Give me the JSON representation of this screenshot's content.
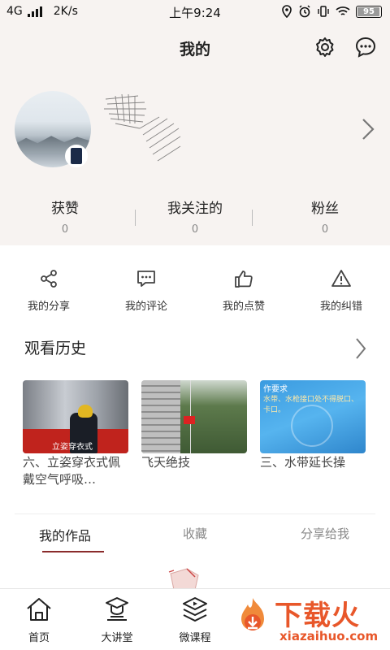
{
  "status": {
    "network": "4G",
    "speed": "2K/s",
    "time": "上午9:24",
    "battery": "95"
  },
  "header": {
    "title": "我的"
  },
  "stats": [
    {
      "label": "获赞",
      "value": "0"
    },
    {
      "label": "我关注的",
      "value": "0"
    },
    {
      "label": "粉丝",
      "value": "0"
    }
  ],
  "actions": [
    {
      "label": "我的分享",
      "icon": "share-icon"
    },
    {
      "label": "我的评论",
      "icon": "comment-icon"
    },
    {
      "label": "我的点赞",
      "icon": "thumbs-up-icon"
    },
    {
      "label": "我的纠错",
      "icon": "warning-icon"
    }
  ],
  "history": {
    "title": "观看历史",
    "items": [
      {
        "caption": "六、立姿穿衣式佩戴空气呼吸…",
        "thumb_text": "立姿穿衣式"
      },
      {
        "caption": "飞天绝技"
      },
      {
        "caption": "三、水带延长操",
        "thumb_text": "作要求",
        "thumb_subtext": "水带、水枪接口处不得脱口、卡口。"
      }
    ]
  },
  "tabs": [
    {
      "label": "我的作品",
      "active": true
    },
    {
      "label": "收藏",
      "active": false
    },
    {
      "label": "分享给我",
      "active": false
    }
  ],
  "bottom_nav": [
    {
      "label": "首页",
      "icon": "home-icon"
    },
    {
      "label": "大讲堂",
      "icon": "lecture-icon"
    },
    {
      "label": "微课程",
      "icon": "course-icon"
    }
  ],
  "watermark": {
    "text": "下载火",
    "url": "xiazaihuo.com"
  },
  "colors": {
    "accent": "#8a2b2b",
    "header_bg": "#f7f3f1",
    "watermark": "#e8572a"
  }
}
